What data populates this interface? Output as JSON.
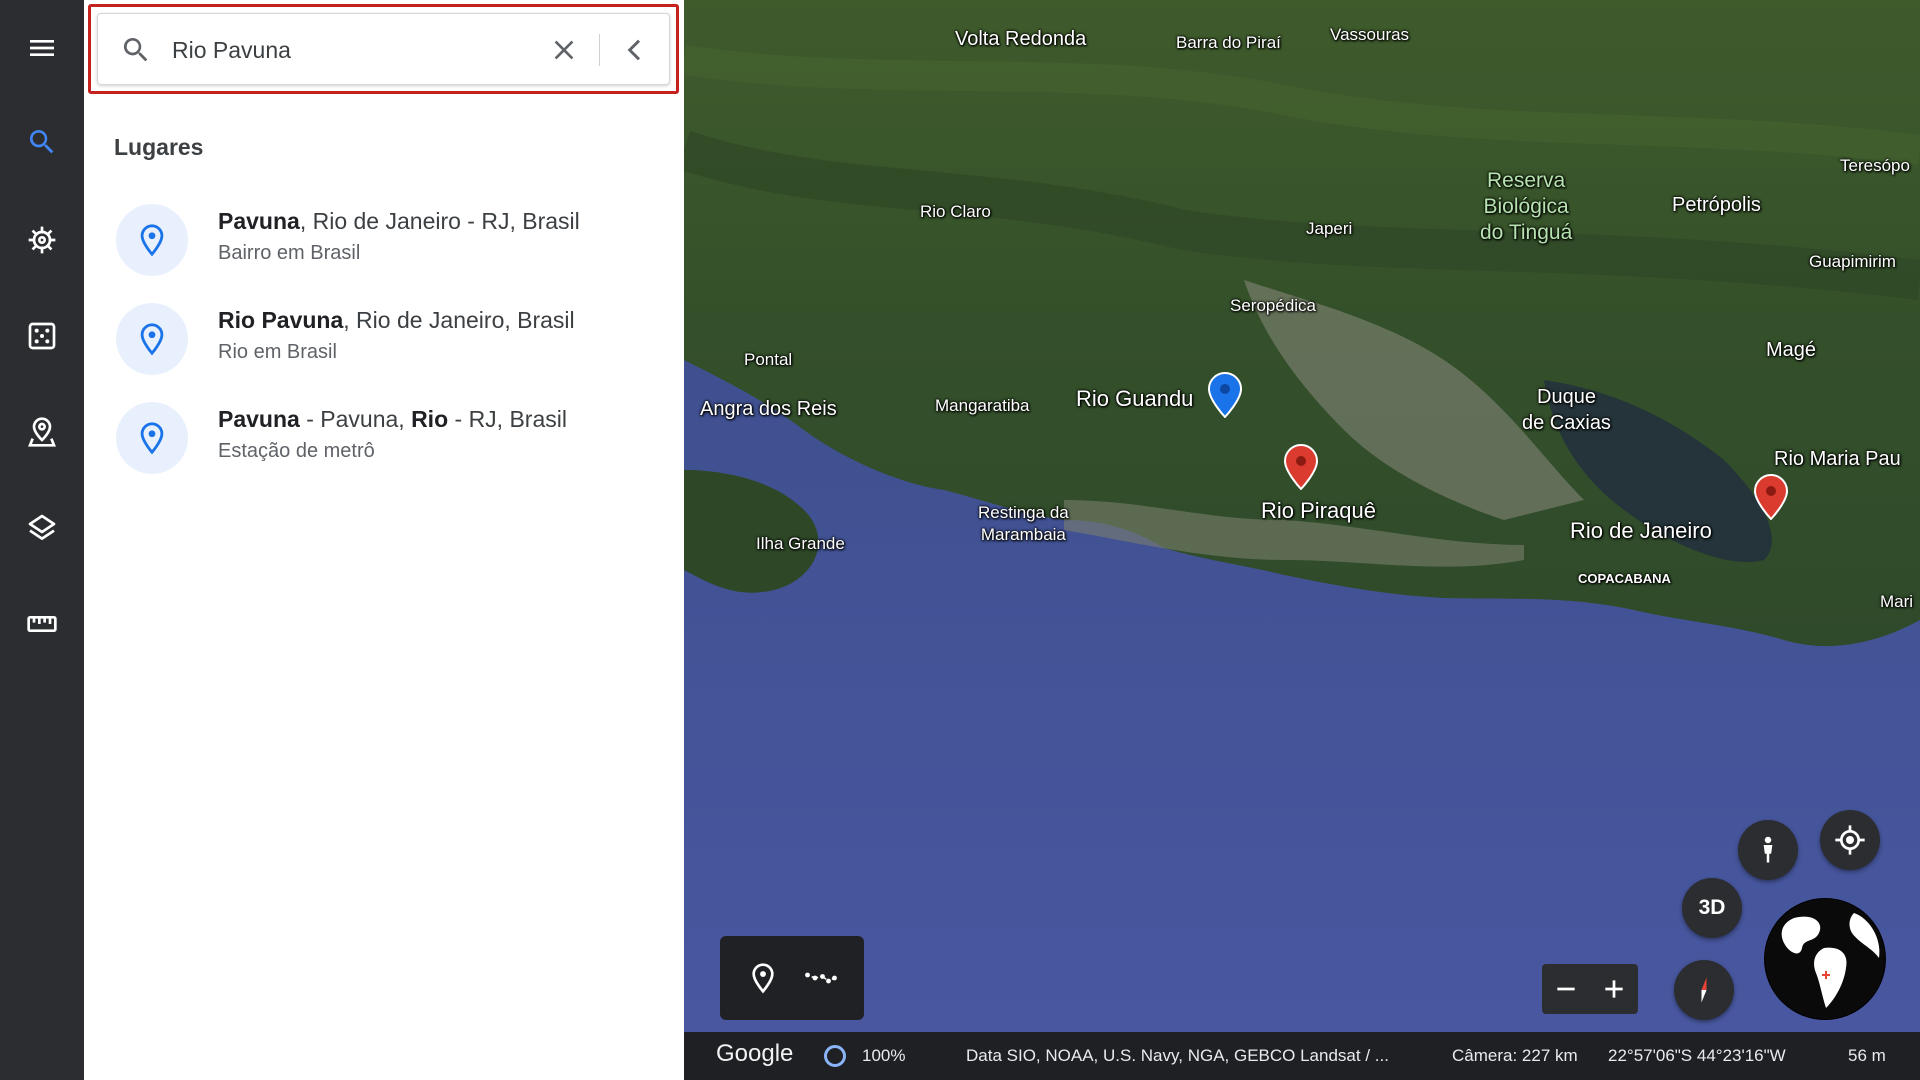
{
  "rail": {
    "items": [
      {
        "name": "menu-icon"
      },
      {
        "name": "search-icon"
      },
      {
        "name": "voyager-icon"
      },
      {
        "name": "feeling-lucky-icon"
      },
      {
        "name": "projects-icon"
      },
      {
        "name": "map-style-icon"
      },
      {
        "name": "measure-icon"
      }
    ],
    "active_color": "#4285f4"
  },
  "search": {
    "value": "Rio Pavuna",
    "placeholder": "Rio Pavuna"
  },
  "results": {
    "section_title": "Lugares",
    "items": [
      {
        "bold1": "Pavuna",
        "rest1": ", Rio de Janeiro - RJ, Brasil",
        "bold2": "",
        "rest2": "",
        "subtitle": "Bairro em Brasil"
      },
      {
        "bold1": "Rio Pavuna",
        "rest1": ", Rio de Janeiro, Brasil",
        "bold2": "",
        "rest2": "",
        "subtitle": "Rio em Brasil"
      },
      {
        "bold1": "Pavuna",
        "rest1": " - Pavuna, ",
        "bold2": "Rio",
        "rest2": " - RJ, Brasil",
        "subtitle": "Estação de metrô"
      }
    ]
  },
  "map": {
    "labels": {
      "volta_redonda": "Volta Redonda",
      "barra_do_pirai": "Barra do Piraí",
      "vassouras": "Vassouras",
      "teresopolis": "Teresópo",
      "reserva": "Reserva\nBiológica\ndo Tinguá",
      "petropolis": "Petrópolis",
      "rio_claro": "Rio Claro",
      "japeri": "Japeri",
      "guapimirim": "Guapimirim",
      "seropedica": "Seropédica",
      "mage": "Magé",
      "pontal": "Pontal",
      "angra": "Angra dos Reis",
      "mangaratiba": "Mangaratiba",
      "rio_guandu": "Rio Guandu",
      "duque": "Duque\nde Caxias",
      "rio_maria": "Rio Maria Pau",
      "rio_piraque": "Rio Piraquê",
      "restinga": "Restinga da\nMarambaia",
      "ilha_grande": "Ilha Grande",
      "rio_de_janeiro": "Rio de Janeiro",
      "copacabana": "COPACABANA",
      "mari": "Mari"
    },
    "controls": {
      "three_d": "3D"
    }
  },
  "status": {
    "brand": "Google",
    "progress": "100%",
    "attribution": "Data SIO, NOAA, U.S. Navy, NGA, GEBCO  Landsat / ...",
    "camera": "Câmera: 227 km",
    "coords": "22°57'06\"S 44°23'16\"W",
    "elevation": "56 m"
  },
  "colors": {
    "search_outline": "#c5221f",
    "pin_blue": "#1a73e8",
    "marker_red": "#db3b2f",
    "marker_blue": "#1a73e8",
    "rail_bg": "#2b2d30"
  }
}
